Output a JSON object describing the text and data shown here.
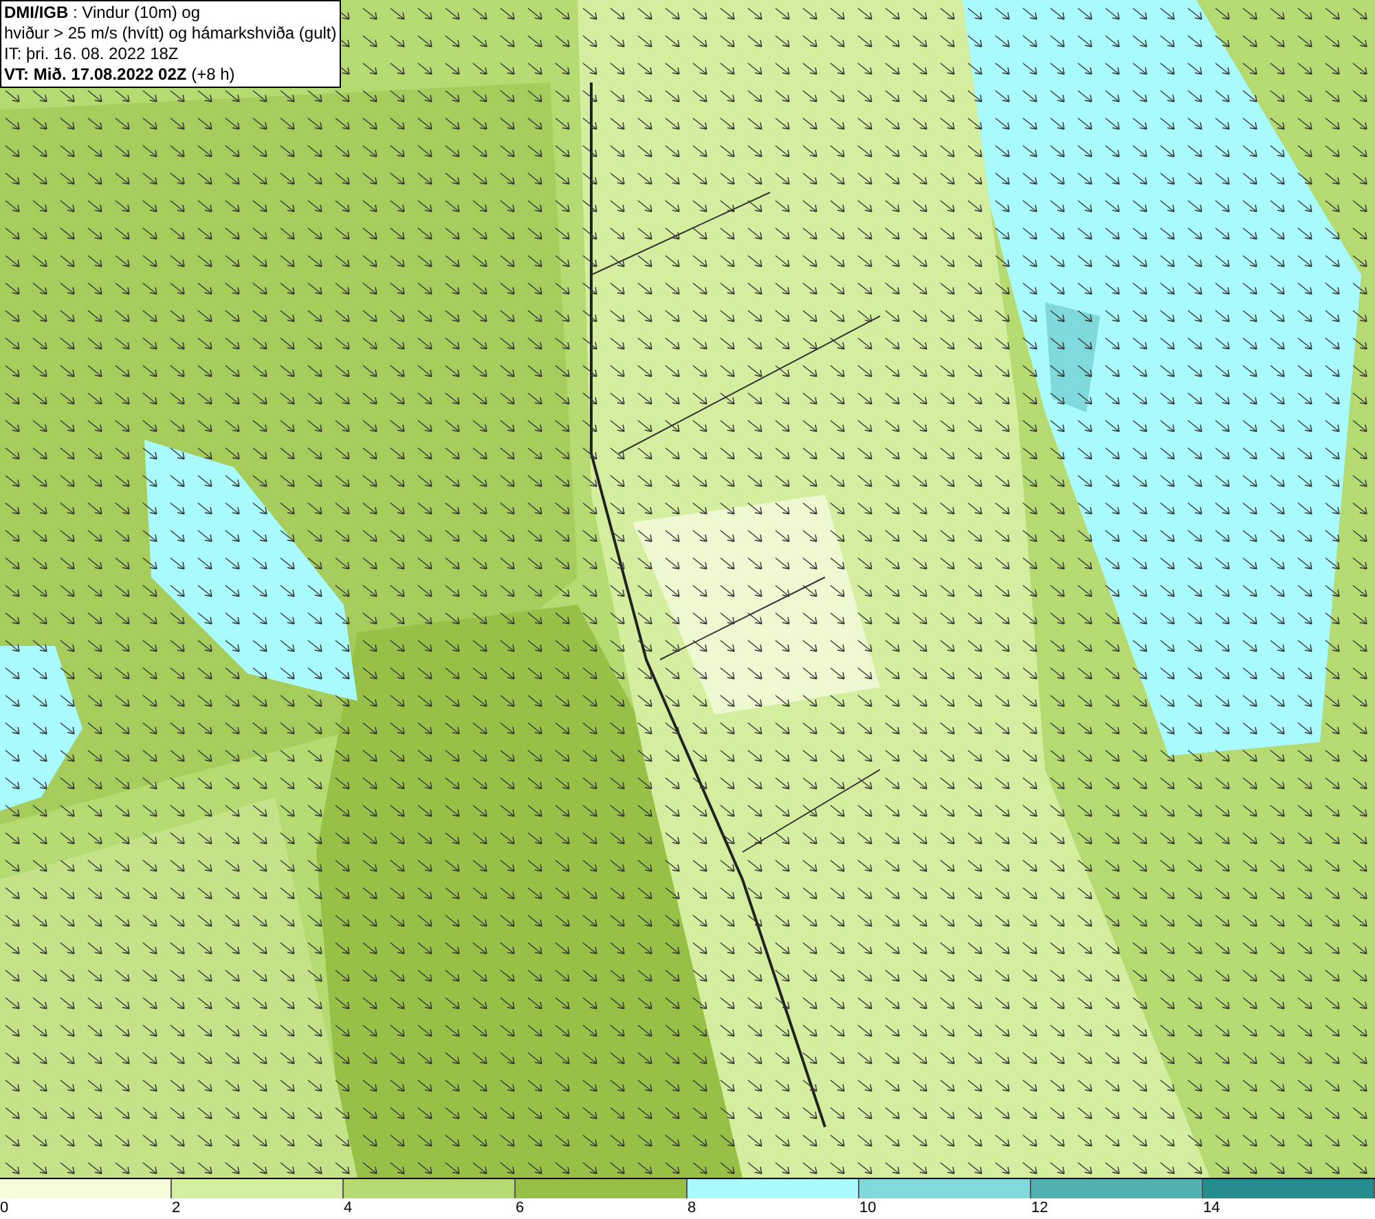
{
  "header": {
    "lines": [
      "**DMI/IGB** : Vindur (10m) og",
      "hviður > 25 m/s (hvítt) og hámarkshviða (gult)",
      "IT: þri. 16. 08. 2022 18Z",
      "**VT: Mið. 17.08.2022 02Z** (+8 h)"
    ]
  },
  "legend": {
    "bins": [
      {
        "color": "#f3fbd9"
      },
      {
        "color": "#d4eea0"
      },
      {
        "color": "#b6da72"
      },
      {
        "color": "#98c046"
      },
      {
        "color": "#a8fafc"
      },
      {
        "color": "#7fd8da"
      },
      {
        "color": "#52b0b2"
      },
      {
        "color": "#248c8c"
      }
    ],
    "ticks": [
      "0",
      "2",
      "4",
      "6",
      "8",
      "10",
      "12",
      "14"
    ]
  }
}
